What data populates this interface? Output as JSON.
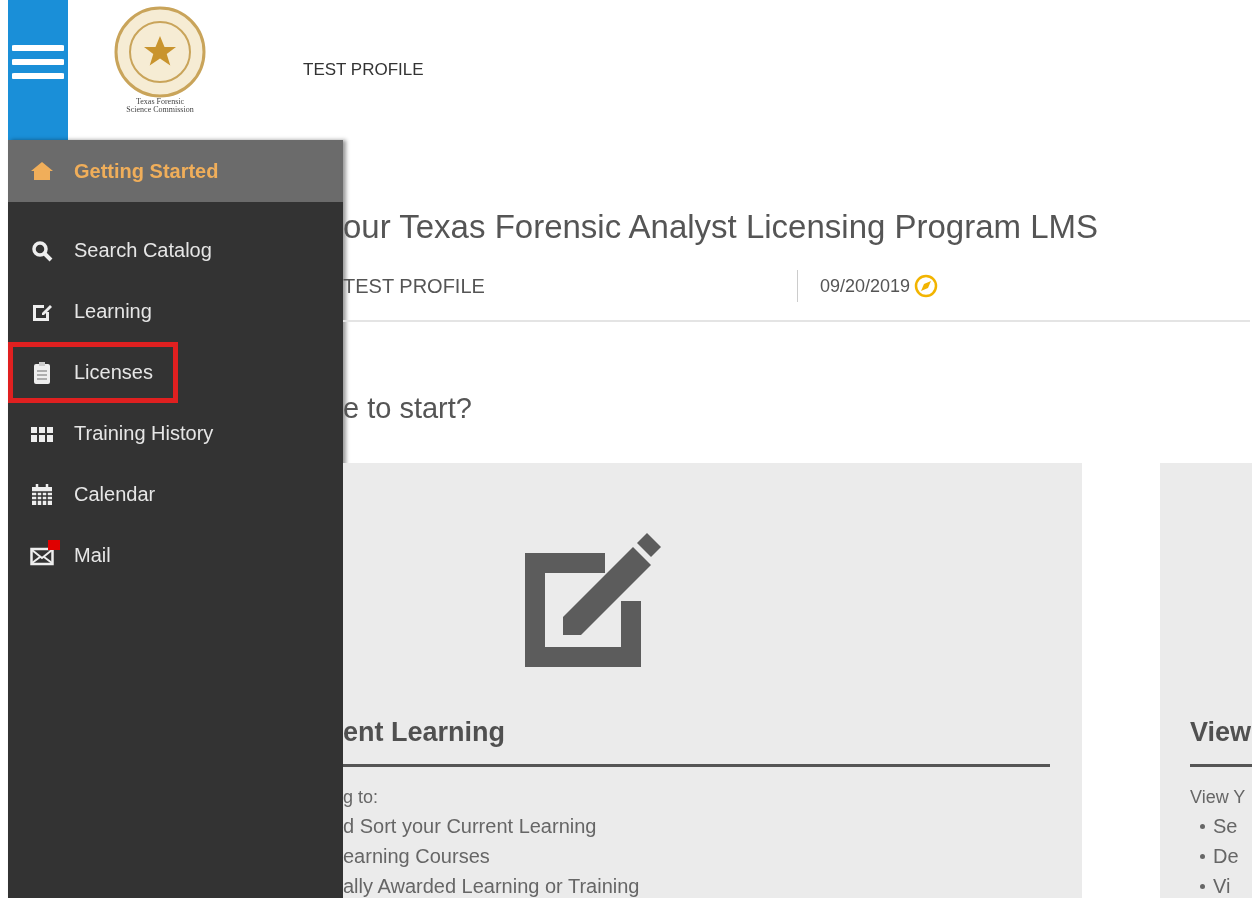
{
  "header": {
    "logo_text": [
      "Texas Forensic",
      "Science Commission"
    ],
    "profile_name": "TEST PROFILE"
  },
  "sidebar": {
    "items": [
      {
        "label": "Getting Started",
        "selected": true,
        "highlighted": false,
        "unread": false
      },
      {
        "label": "Search Catalog",
        "selected": false,
        "highlighted": false,
        "unread": false
      },
      {
        "label": "Learning",
        "selected": false,
        "highlighted": false,
        "unread": false
      },
      {
        "label": "Licenses",
        "selected": false,
        "highlighted": true,
        "unread": false
      },
      {
        "label": "Training History",
        "selected": false,
        "highlighted": false,
        "unread": false
      },
      {
        "label": "Calendar",
        "selected": false,
        "highlighted": false,
        "unread": false
      },
      {
        "label": "Mail",
        "selected": false,
        "highlighted": false,
        "unread": true
      }
    ]
  },
  "main": {
    "title": "our Texas Forensic Analyst Licensing Program LMS",
    "user": "TEST PROFILE",
    "date": "09/20/2019",
    "prompt": "e to start?",
    "cards": [
      {
        "heading": "ent Learning",
        "intro": "g to:",
        "items": [
          "d Sort your Current Learning",
          "earning Courses",
          "ally Awarded Learning or Training"
        ]
      },
      {
        "heading": "View",
        "intro": "View Y",
        "items": [
          "Se",
          "De",
          "Vi"
        ]
      }
    ]
  }
}
